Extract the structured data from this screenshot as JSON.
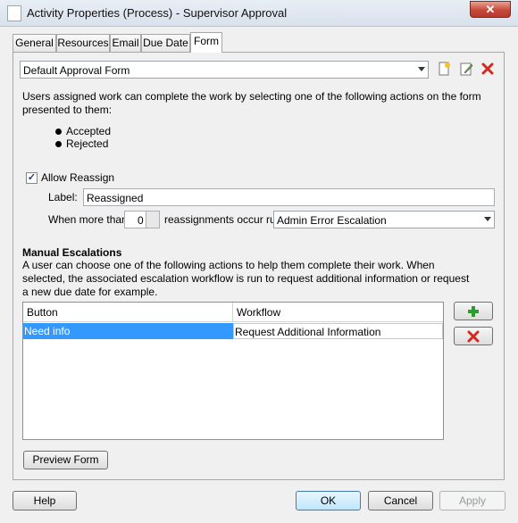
{
  "window": {
    "title": "Activity Properties (Process) - Supervisor Approval"
  },
  "tabs": [
    {
      "label": "General"
    },
    {
      "label": "Resources"
    },
    {
      "label": "Email"
    },
    {
      "label": "Due Date"
    },
    {
      "label": "Form"
    }
  ],
  "form": {
    "selected_form": "Default Approval Form",
    "intro_text": "Users assigned work can complete the work by selecting one of the following actions on the form presented to them:",
    "actions": [
      "Accepted",
      "Rejected"
    ],
    "allow_reassign": {
      "label": "Allow Reassign",
      "checked": true
    },
    "label_field": {
      "label": "Label:",
      "value": "Reassigned"
    },
    "reassign_rule": {
      "prefix": "When more than",
      "count": "0",
      "suffix": "reassignments occur run",
      "workflow": "Admin Error Escalation"
    }
  },
  "manual_escalations": {
    "heading": "Manual Escalations",
    "description": "A user can choose one of the following actions to help them complete their work. When selected, the associated escalation workflow is run to request additional information or request a new due date for example.",
    "columns": [
      "Button",
      "Workflow"
    ],
    "rows": [
      {
        "button": "Need info",
        "workflow": "Request Additional Information",
        "selected": true
      }
    ],
    "preview_label": "Preview Form"
  },
  "footer": {
    "help": "Help",
    "ok": "OK",
    "cancel": "Cancel",
    "apply": "Apply"
  },
  "colors": {
    "selection": "#3399ff",
    "add": "#2e9b2e",
    "delete": "#d32a1f"
  }
}
